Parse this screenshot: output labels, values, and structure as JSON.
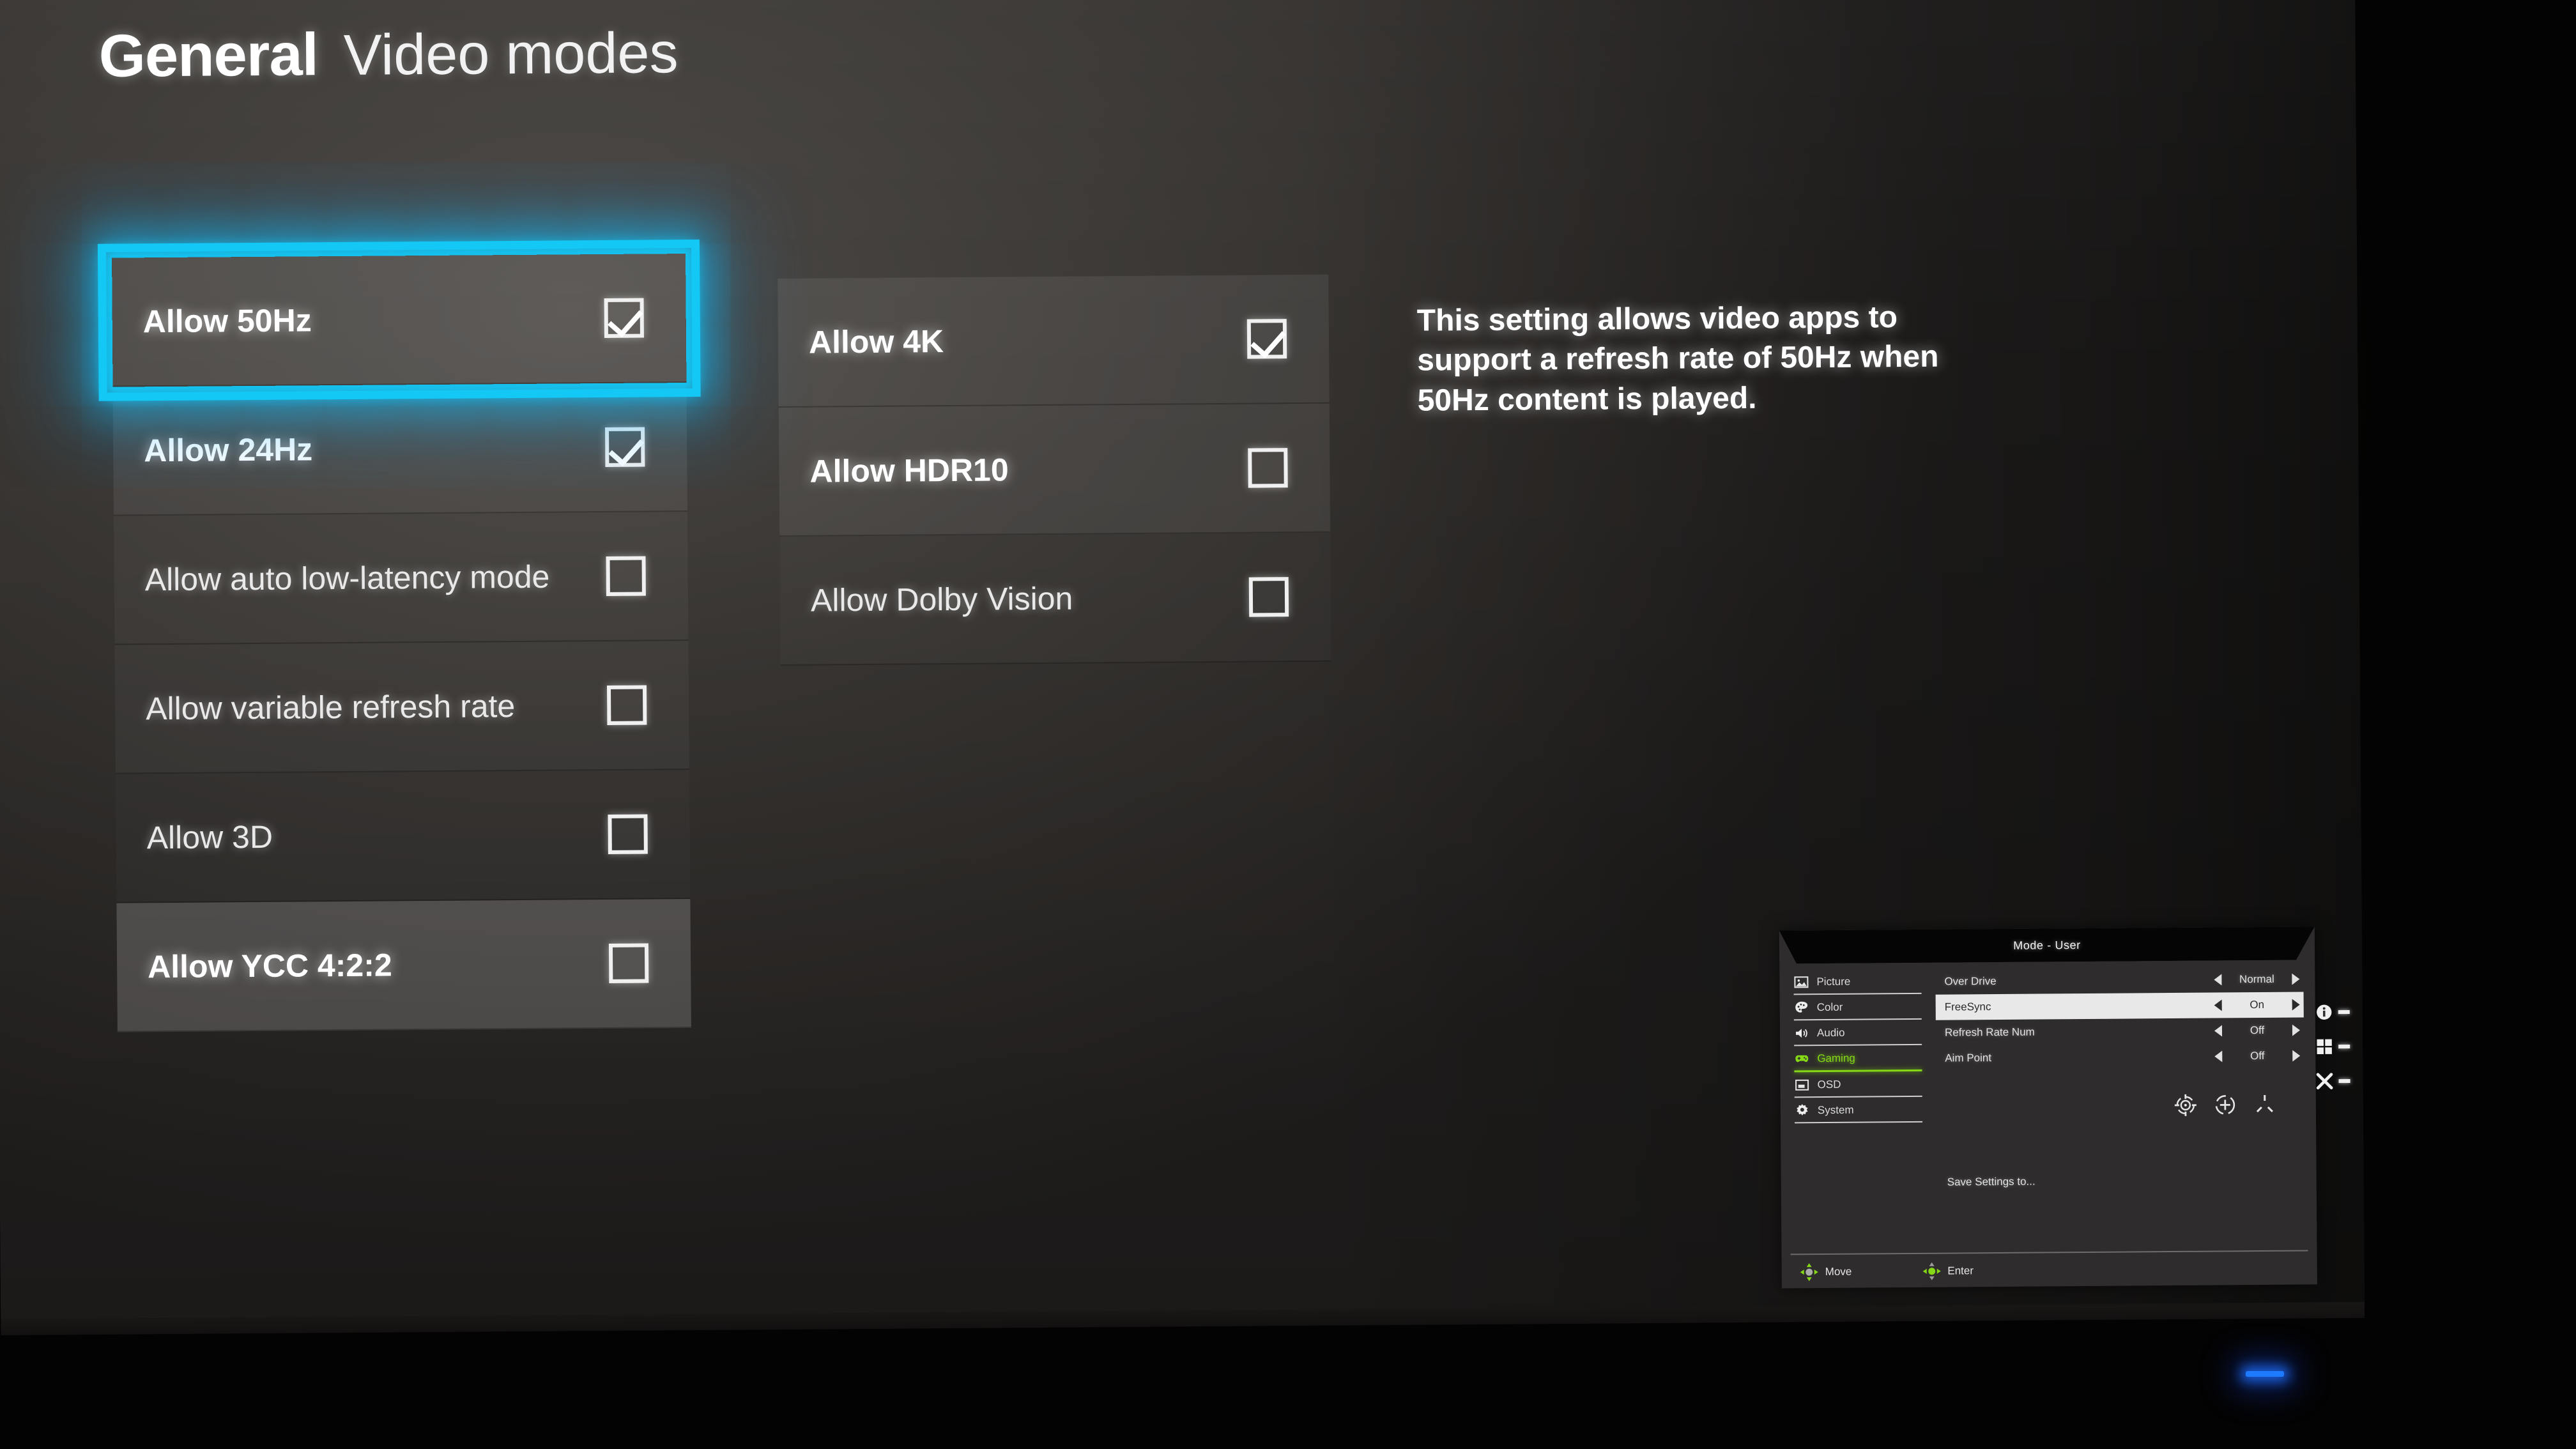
{
  "header": {
    "title_bold": "General",
    "title_light": "Video modes"
  },
  "colors": {
    "focus_glow": "#14c8f5",
    "osd_accent_green": "#84d816",
    "power_led_blue": "#1e7bff"
  },
  "left_list": [
    {
      "label": "Allow 50Hz",
      "checked": "checked",
      "state": "focused"
    },
    {
      "label": "Allow 24Hz",
      "checked": "checked",
      "state": "alt"
    },
    {
      "label": "Allow auto low-latency mode",
      "checked": "unchecked",
      "state": "plain"
    },
    {
      "label": "Allow variable refresh rate",
      "checked": "unchecked",
      "state": "plain"
    },
    {
      "label": "Allow 3D",
      "checked": "unchecked",
      "state": "dim"
    },
    {
      "label": "Allow YCC 4:2:2",
      "checked": "unchecked",
      "state": "shade"
    }
  ],
  "middle_list": [
    {
      "label": "Allow 4K",
      "checked": "checked",
      "state": "alt"
    },
    {
      "label": "Allow HDR10",
      "checked": "unchecked",
      "state": "alt"
    },
    {
      "label": "Allow Dolby Vision",
      "checked": "unchecked",
      "state": "dim"
    }
  ],
  "description": "This setting allows video apps to support a refresh rate of 50Hz when 50Hz content is played.",
  "osd": {
    "title": "Mode - User",
    "nav": [
      {
        "label": "Picture",
        "icon": "image-icon",
        "active": false
      },
      {
        "label": "Color",
        "icon": "palette-icon",
        "active": false
      },
      {
        "label": "Audio",
        "icon": "speaker-icon",
        "active": false
      },
      {
        "label": "Gaming",
        "icon": "gamepad-icon",
        "active": true
      },
      {
        "label": "OSD",
        "icon": "osd-icon",
        "active": false
      },
      {
        "label": "System",
        "icon": "gear-icon",
        "active": false
      }
    ],
    "options": [
      {
        "name": "Over Drive",
        "value": "Normal",
        "selected": false
      },
      {
        "name": "FreeSync",
        "value": "On",
        "selected": true
      },
      {
        "name": "Refresh Rate Num",
        "value": "Off",
        "selected": false
      },
      {
        "name": "Aim Point",
        "value": "Off",
        "selected": false
      }
    ],
    "aim_icons": [
      "crosshair-dot-icon",
      "crosshair-plus-icon",
      "reticle-marks-icon"
    ],
    "save_label": "Save Settings to...",
    "hints": [
      {
        "label": "Move",
        "icon": "dpad-icon"
      },
      {
        "label": "Enter",
        "icon": "dpad-green-icon"
      }
    ],
    "side_buttons": [
      {
        "icon": "info-icon"
      },
      {
        "icon": "grid-icon"
      },
      {
        "icon": "close-icon"
      }
    ]
  }
}
